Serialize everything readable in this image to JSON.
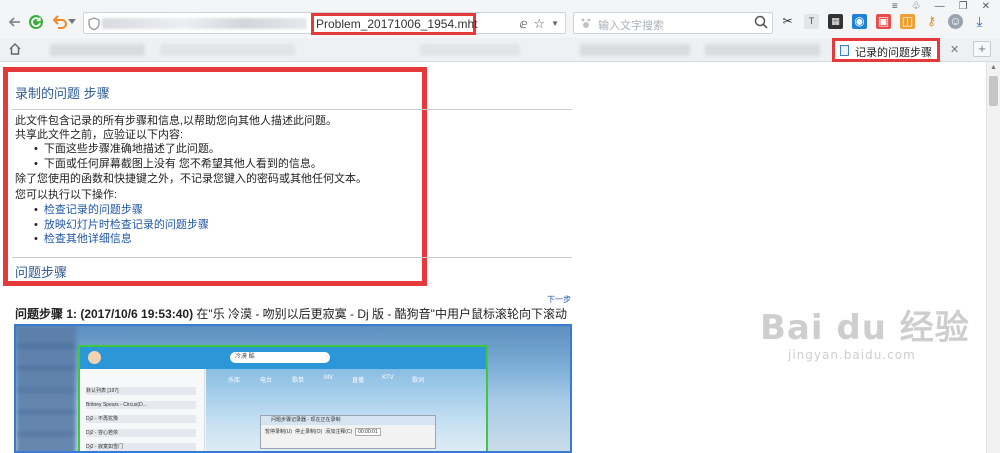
{
  "toolbar": {
    "address_value": "Problem_20171006_1954.mht",
    "search_placeholder": "输入文字搜索"
  },
  "tabs": {
    "active_label": "记录的问题步骤"
  },
  "doc": {
    "title": "录制的问题 步骤",
    "intro": "此文件包含记录的所有步骤和信息,以帮助您向其他人描述此问题。",
    "share_heading": "共享此文件之前，应验证以下内容:",
    "check_items": [
      "下面这些步骤准确地描述了此问题。",
      "下面或任何屏幕截图上没有 您不希望其他人看到的信息。"
    ],
    "note": "除了您使用的函数和快捷键之外，不记录您键入的密码或其他任何文本。",
    "actions_heading": "您可以执行以下操作:",
    "actions": [
      "检查记录的问题步骤",
      "放映幻灯片时检查记录的问题步骤",
      "检查其他详细信息"
    ],
    "steps_heading": "问题步骤",
    "next_link": "下一步",
    "step1_label": "问题步骤 1: (2017/10/6 19:53:40)",
    "step1_text": " 在\"乐 冷漠 - 吻别以后更寂寞 - Dj 版 - 酷狗音\"中用户鼠标滚轮向下滚动"
  },
  "thumbnail": {
    "tabs": [
      "乐库",
      "电台",
      "歌单",
      "MV",
      "直播",
      "KTV",
      "歌词"
    ],
    "dialog_title": "问题步骤记录器 - 现在正在录制",
    "dialog_buttons": [
      "暂停录制(U)",
      "停止录制(O)",
      "添加注释(C)"
    ],
    "dialog_time": "00:00:01",
    "search_text": "冷漠 酷",
    "list_items": [
      "默认列表 [197]",
      "Britney Spears - Circus(D...",
      "Dj2 - 不再犹豫",
      "Dj2 - 容心若依",
      "Dj2 - 寂寞如雪门"
    ]
  },
  "watermark": {
    "brand": "Bai du 经验",
    "url": "jingyan.baidu.com"
  },
  "colors": {
    "highlight": "#e5393b",
    "heading": "#2f5b96",
    "link": "#1f57a8"
  }
}
